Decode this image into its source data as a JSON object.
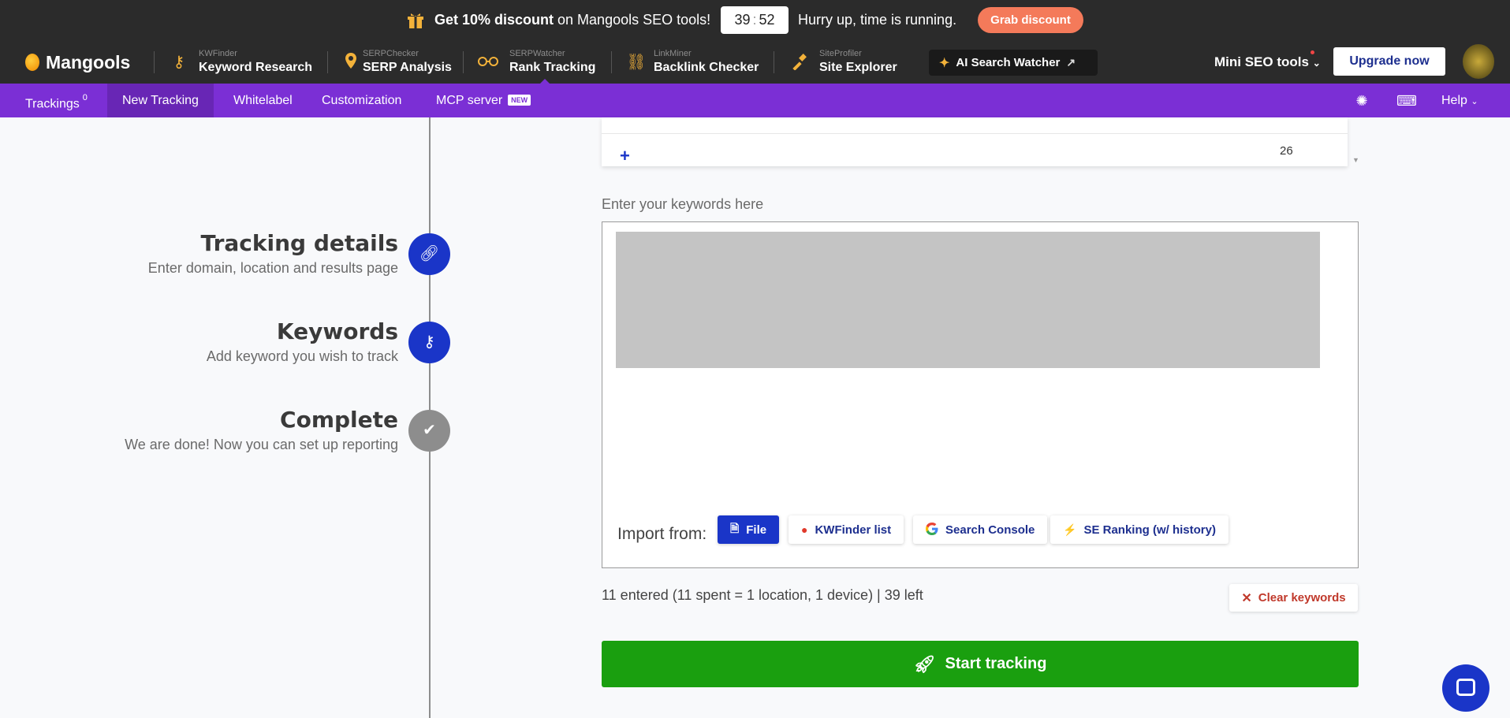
{
  "promo": {
    "discount_bold": "Get 10% discount",
    "discount_rest": " on Mangools SEO tools!",
    "timer_min": "39",
    "timer_sep": ":",
    "timer_sec": "52",
    "hurry": "Hurry up, time is running.",
    "grab": "Grab discount"
  },
  "header": {
    "brand": "Mangools",
    "tools": [
      {
        "small": "KWFinder",
        "big": "Keyword Research",
        "icon": "key-icon"
      },
      {
        "small": "SERPChecker",
        "big": "SERP Analysis",
        "icon": "pin-icon"
      },
      {
        "small": "SERPWatcher",
        "big": "Rank Tracking",
        "icon": "glasses-icon"
      },
      {
        "small": "LinkMiner",
        "big": "Backlink Checker",
        "icon": "link-icon"
      },
      {
        "small": "SiteProfiler",
        "big": "Site Explorer",
        "icon": "hammer-icon"
      }
    ],
    "ai_watcher": "AI Search Watcher",
    "mini_seo": "Mini SEO tools",
    "upgrade": "Upgrade now"
  },
  "subnav": {
    "trackings": "Trackings",
    "trackings_count": "0",
    "new_tracking": "New Tracking",
    "whitelabel": "Whitelabel",
    "customization": "Customization",
    "mcp": "MCP server",
    "new_badge": "NEW",
    "help": "Help"
  },
  "steps": [
    {
      "title": "Tracking details",
      "subtitle": "Enter domain, location and results page"
    },
    {
      "title": "Keywords",
      "subtitle": "Add keyword you wish to track"
    },
    {
      "title": "Complete",
      "subtitle": "We are done! Now you can set up reporting"
    }
  ],
  "form": {
    "location_count": "26",
    "keywords_label": "Enter your keywords here",
    "import_label": "Import from:",
    "import_buttons": [
      "File",
      "KWFinder list",
      "Search Console",
      "SE Ranking (w/ history)"
    ],
    "count_text": "11 entered (11 spent = 1 location, 1 device) | 39 left",
    "clear": "Clear keywords",
    "start": "Start tracking"
  },
  "colors": {
    "primary": "#1a35c8",
    "purple": "#7b2fd5",
    "green": "#1a9f0f",
    "dark": "#2b2b2b",
    "accent_orange": "#f47a5a"
  }
}
